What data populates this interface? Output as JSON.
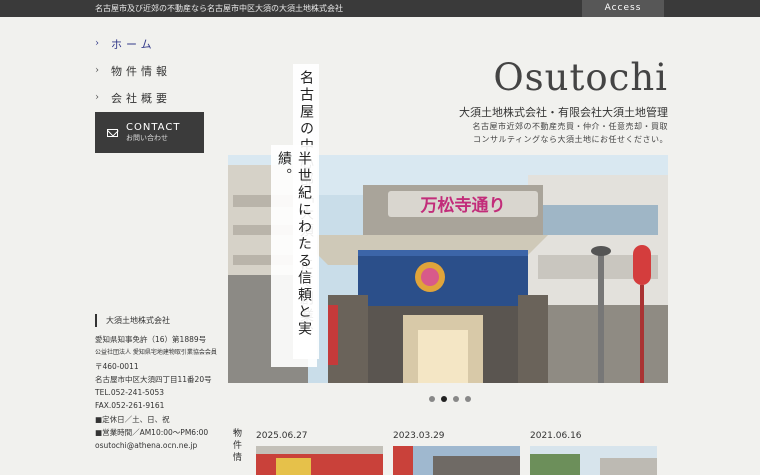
{
  "header": {
    "tagline": "名古屋市及び近郊の不動産なら名古屋市中区大須の大須土地株式会社",
    "access_label": "Access"
  },
  "nav": {
    "items": [
      {
        "label": "ホーム",
        "active": true
      },
      {
        "label": "物件情報",
        "active": false
      },
      {
        "label": "会社概要",
        "active": false
      }
    ]
  },
  "contact": {
    "label": "CONTACT",
    "sub_label": "お問い合わせ",
    "icon": "mail-icon"
  },
  "brand": {
    "logo": "Osutochi",
    "company": "大須土地株式会社・有限会社大須土地管理",
    "tagline_line1": "名古屋市近郊の不動産売買・仲介・任意売却・買取",
    "tagline_line2": "コンサルティングなら大須土地にお任せください。"
  },
  "hero": {
    "vertical_line1": "名古屋の中心部「大須」にて創業、",
    "vertical_line2": "半世紀にわたる信頼と実績。",
    "sign_text": "万松寺通り",
    "slides": [
      {
        "active": false
      },
      {
        "active": true
      },
      {
        "active": false
      },
      {
        "active": false
      }
    ]
  },
  "company_info": {
    "name": "大須土地株式会社",
    "license": "愛知県知事免許（16）第1889号",
    "association": "公益社団法人 愛知県宅地建物取引業協会会員",
    "zip": "〒460-0011",
    "address": "名古屋市中区大須四丁目11番20号",
    "tel": "TEL.052-241-5053",
    "fax": "FAX.052-261-9161",
    "holiday": "■定休日／土、日、祝",
    "hours": "■営業時間／AM10:00〜PM6:00",
    "email": "osutochi@athena.ocn.ne.jp"
  },
  "news": {
    "label": "物件情",
    "items": [
      {
        "date": "2025.06.27"
      },
      {
        "date": "2023.03.29"
      },
      {
        "date": "2021.06.16"
      }
    ]
  },
  "colors": {
    "accent": "#333a8a",
    "dark": "#3a3a3a",
    "background": "#f1f1ee"
  }
}
